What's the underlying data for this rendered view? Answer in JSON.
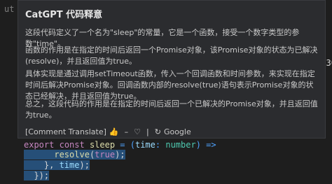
{
  "popup": {
    "title": "CatGPT 代码释意",
    "paragraphs": [
      "这段代码定义了一个名为\"sleep\"的常量，它是一个函数，接受一个数字类型的参数\"time\"。",
      "函数的作用是在指定的时间后返回一个Promise对象，该Promise对象的状态为已解决(resolve)，并且返回值为true。",
      "具体实现是通过调用setTimeout函数，传入一个回调函数和时间参数，来实现在指定时间后解决Promise对象。回调函数内部的resolve(true)语句表示Promise对象的状态已经解决，并且返回值为true。",
      "总之，这段代码的作用是在指定的时间后返回一个已解决的Promise对象，并且返回值为true。"
    ],
    "actions": {
      "comment_translate": "[Comment Translate]",
      "google": "Google"
    }
  },
  "editor": {
    "top_snippet": "ut",
    "right_snippet": ".ng(36",
    "code_lines": [
      "export const sleep = (time: number) =>",
      "resolve(true);",
      "}, time);",
      "});"
    ]
  }
}
